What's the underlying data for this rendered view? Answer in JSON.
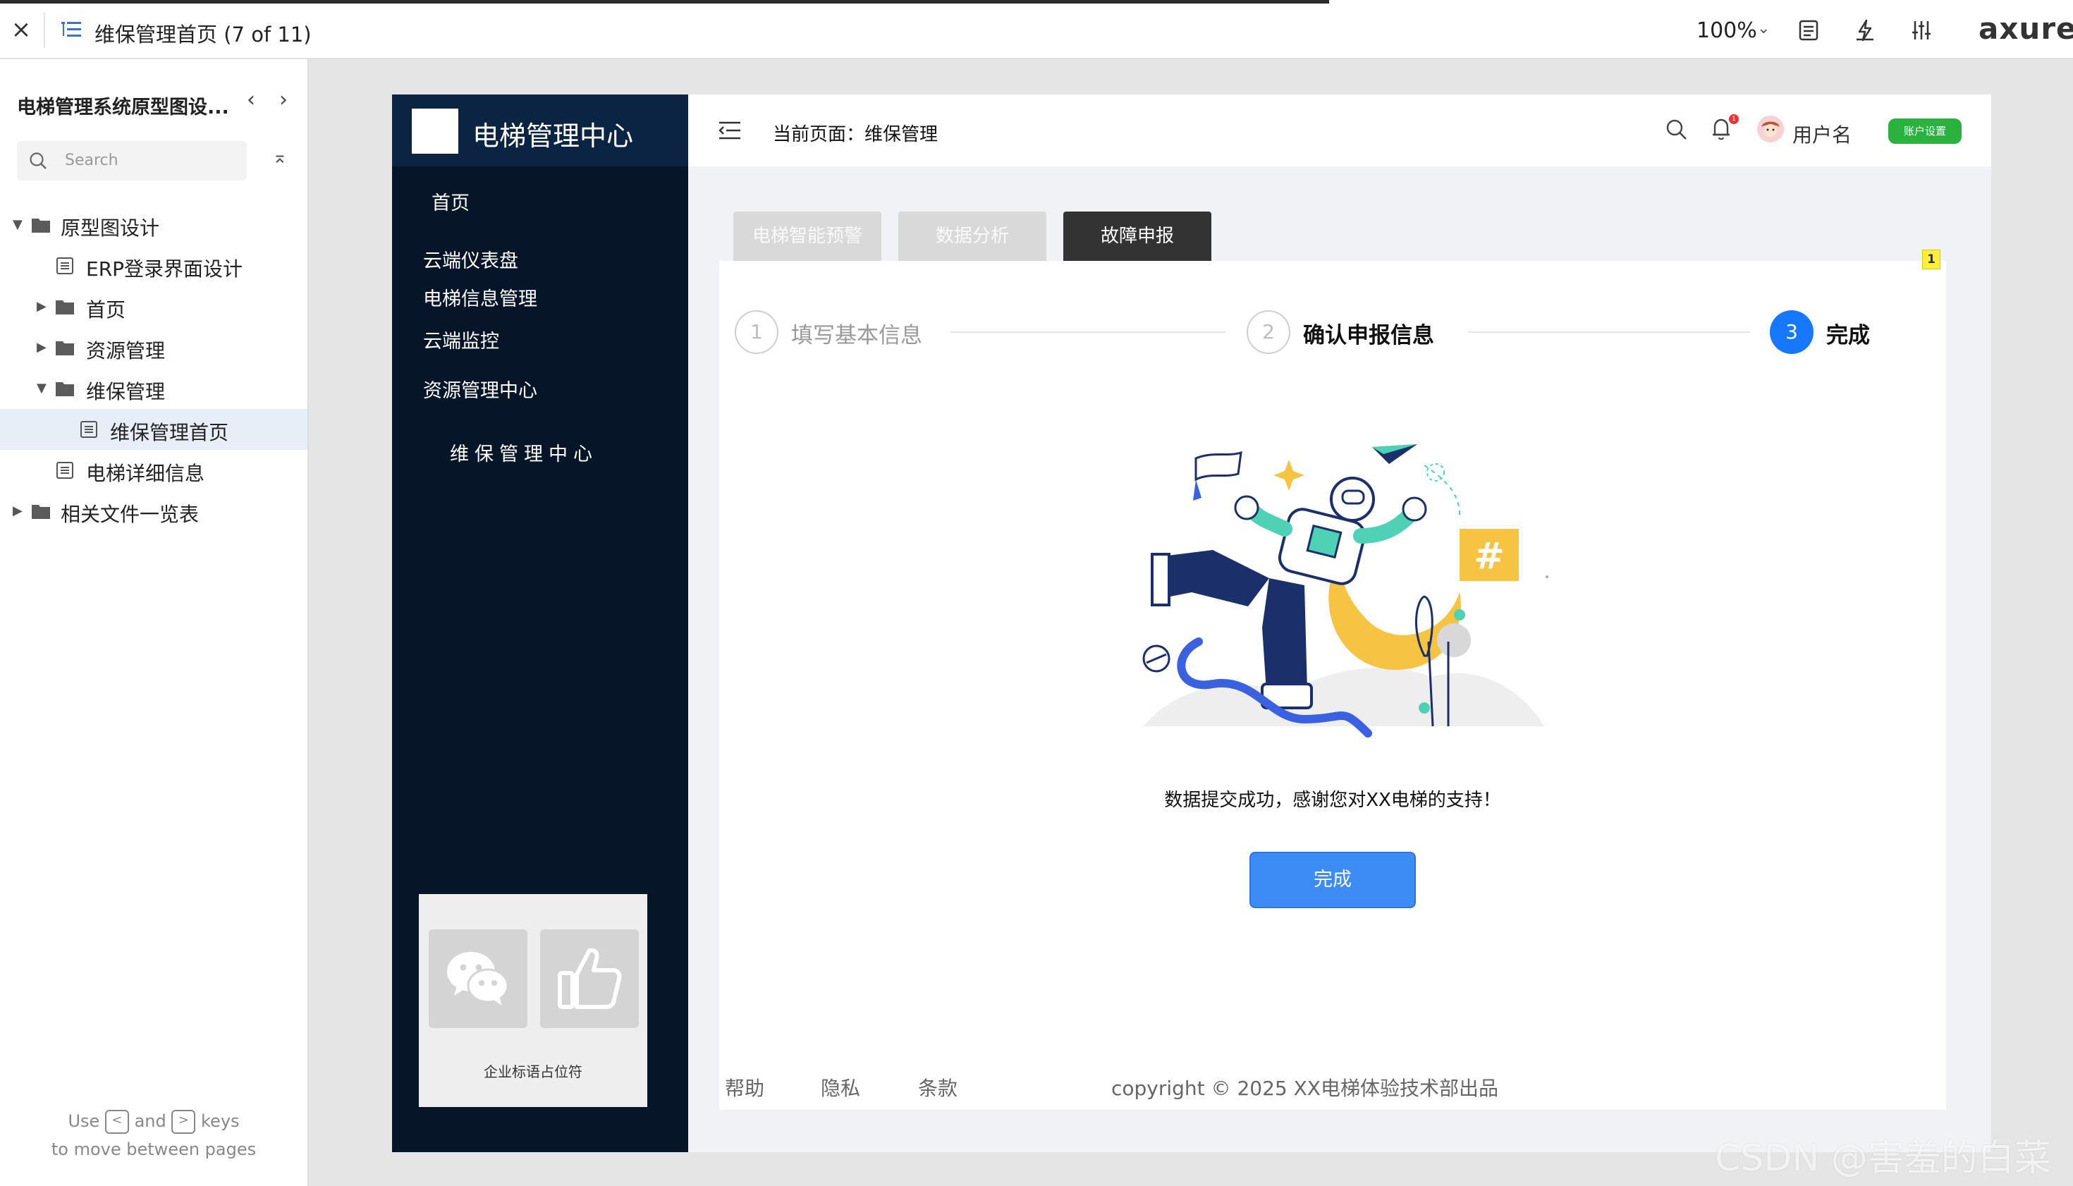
{
  "toolbar": {
    "page_title": "维保管理首页  (7 of 11)",
    "zoom": "100%",
    "logo": "axure"
  },
  "sitemap": {
    "project_name": "电梯管理系统原型图设...",
    "search_placeholder": "Search",
    "tree": [
      {
        "label": "原型图设计",
        "type": "folder",
        "expanded": true
      },
      {
        "label": "ERP登录界面设计",
        "type": "page"
      },
      {
        "label": "首页",
        "type": "folder",
        "expanded": false
      },
      {
        "label": "资源管理",
        "type": "folder",
        "expanded": false
      },
      {
        "label": "维保管理",
        "type": "folder",
        "expanded": true
      },
      {
        "label": "维保管理首页",
        "type": "page",
        "selected": true
      },
      {
        "label": "电梯详细信息",
        "type": "page"
      },
      {
        "label": "相关文件一览表",
        "type": "folder",
        "expanded": false
      }
    ],
    "hint_use": "Use",
    "hint_and": "and",
    "hint_keys": "keys",
    "hint_line2": "to move between pages",
    "key_prev": "<",
    "key_next": ">"
  },
  "app": {
    "brand": "电梯管理中心",
    "menu": [
      "首页",
      "云端仪表盘",
      "电梯信息管理",
      "云端监控",
      "资源管理中心"
    ],
    "submenu_active": "维保管理中心",
    "side_card_caption": "企业标语占位符",
    "header": {
      "breadcrumb": "当前页面：维保管理",
      "username": "用户名",
      "settings_button": "账户设置",
      "notification_count": "1"
    },
    "tabs": [
      {
        "label": "电梯智能预警",
        "active": false
      },
      {
        "label": "数据分析",
        "active": false
      },
      {
        "label": "故障申报",
        "active": true
      }
    ],
    "note_badge": "1",
    "steps": [
      {
        "number": "1",
        "label": "填写基本信息",
        "state": "todo"
      },
      {
        "number": "2",
        "label": "确认申报信息",
        "state": "todo"
      },
      {
        "number": "3",
        "label": "完成",
        "state": "current"
      }
    ],
    "success_message": "数据提交成功，感谢您对XX电梯的支持！",
    "done_button": "完成",
    "footer": {
      "links": [
        "帮助",
        "隐私",
        "条款"
      ],
      "copyright": "copyright  © 2025 XX电梯体验技术部出品"
    }
  },
  "watermark": "CSDN @害羞的白菜",
  "colors": {
    "sidebar_dark": "#061528",
    "brand_bar": "#0c2443",
    "primary": "#1677ff",
    "button": "#3d8bf5",
    "settings_green": "#29b33e",
    "tab_active": "#333333",
    "tab_inactive": "#d9d9d9"
  }
}
